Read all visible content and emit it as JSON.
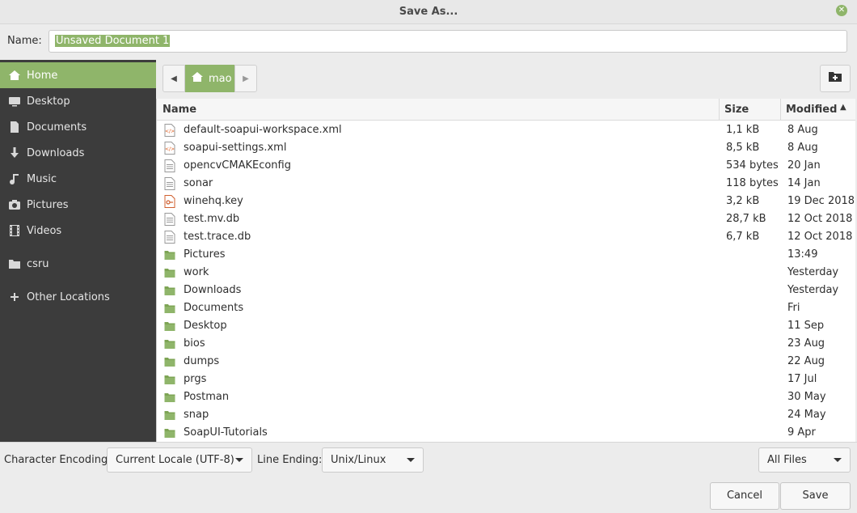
{
  "window": {
    "title": "Save As..."
  },
  "name_field": {
    "label": "Name:",
    "value": "Unsaved Document 1"
  },
  "sidebar": {
    "items": [
      {
        "label": "Home",
        "icon": "home-icon",
        "active": true
      },
      {
        "label": "Desktop",
        "icon": "desktop-icon"
      },
      {
        "label": "Documents",
        "icon": "document-icon"
      },
      {
        "label": "Downloads",
        "icon": "download-icon"
      },
      {
        "label": "Music",
        "icon": "music-icon"
      },
      {
        "label": "Pictures",
        "icon": "camera-icon"
      },
      {
        "label": "Videos",
        "icon": "film-icon"
      },
      {
        "label": "csru",
        "icon": "folder-icon"
      },
      {
        "label": "Other Locations",
        "icon": "plus-icon"
      }
    ]
  },
  "pathbar": {
    "current": "mao"
  },
  "columns": {
    "name": "Name",
    "size": "Size",
    "modified": "Modified"
  },
  "files": [
    {
      "name": "default-soapui-workspace.xml",
      "size": "1,1 kB",
      "modified": "8 Aug",
      "type": "xml"
    },
    {
      "name": "soapui-settings.xml",
      "size": "8,5 kB",
      "modified": "8 Aug",
      "type": "xml"
    },
    {
      "name": "opencvCMAKEconfig",
      "size": "534 bytes",
      "modified": "20 Jan",
      "type": "text"
    },
    {
      "name": "sonar",
      "size": "118 bytes",
      "modified": "14 Jan",
      "type": "text"
    },
    {
      "name": "winehq.key",
      "size": "3,2 kB",
      "modified": "19 Dec 2018",
      "type": "key"
    },
    {
      "name": "test.mv.db",
      "size": "28,7 kB",
      "modified": "12 Oct 2018",
      "type": "text"
    },
    {
      "name": "test.trace.db",
      "size": "6,7 kB",
      "modified": "12 Oct 2018",
      "type": "text"
    },
    {
      "name": "Pictures",
      "size": "",
      "modified": "13:49",
      "type": "folder"
    },
    {
      "name": "work",
      "size": "",
      "modified": "Yesterday",
      "type": "folder"
    },
    {
      "name": "Downloads",
      "size": "",
      "modified": "Yesterday",
      "type": "folder"
    },
    {
      "name": "Documents",
      "size": "",
      "modified": "Fri",
      "type": "folder"
    },
    {
      "name": "Desktop",
      "size": "",
      "modified": "11 Sep",
      "type": "folder"
    },
    {
      "name": "bios",
      "size": "",
      "modified": "23 Aug",
      "type": "folder"
    },
    {
      "name": "dumps",
      "size": "",
      "modified": "22 Aug",
      "type": "folder"
    },
    {
      "name": "prgs",
      "size": "",
      "modified": "17 Jul",
      "type": "folder"
    },
    {
      "name": "Postman",
      "size": "",
      "modified": "30 May",
      "type": "folder"
    },
    {
      "name": "snap",
      "size": "",
      "modified": "24 May",
      "type": "folder"
    },
    {
      "name": "SoapUI-Tutorials",
      "size": "",
      "modified": "9 Apr",
      "type": "folder"
    }
  ],
  "bottom": {
    "encoding_label": "Character Encoding:",
    "encoding_value": "Current Locale (UTF-8)",
    "line_ending_label": "Line Ending:",
    "line_ending_value": "Unix/Linux",
    "filter_value": "All Files",
    "cancel_label": "Cancel",
    "save_label": "Save"
  },
  "colors": {
    "accent": "#8fb56a",
    "sidebar_bg": "#3c3c3c",
    "window_bg": "#ececec"
  }
}
